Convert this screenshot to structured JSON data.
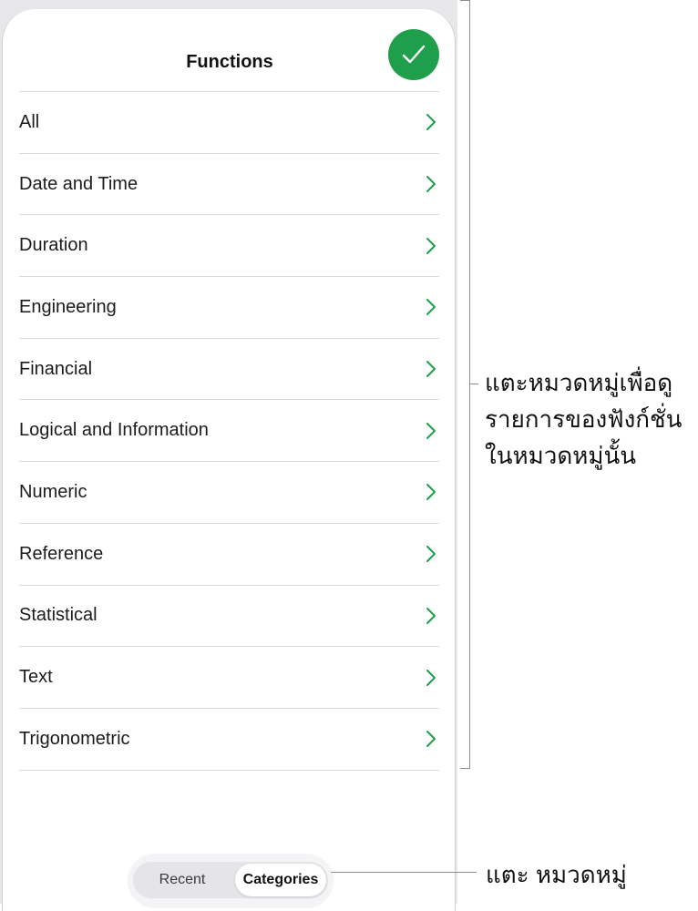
{
  "panel": {
    "title": "Functions",
    "done_icon": "checkmark-icon",
    "accent_color": "#1f9f4c"
  },
  "categories": [
    {
      "label": "All"
    },
    {
      "label": "Date and Time"
    },
    {
      "label": "Duration"
    },
    {
      "label": "Engineering"
    },
    {
      "label": "Financial"
    },
    {
      "label": "Logical and Information"
    },
    {
      "label": "Numeric"
    },
    {
      "label": "Reference"
    },
    {
      "label": "Statistical"
    },
    {
      "label": "Text"
    },
    {
      "label": "Trigonometric"
    }
  ],
  "segmented_control": {
    "options": [
      "Recent",
      "Categories"
    ],
    "selected": "Categories"
  },
  "annotations": {
    "list_callout": "แตะหมวดหมู่เพื่อดูรายการของฟังก์ชั่นในหมวดหมู่นั้น",
    "segment_callout": "แตะ หมวดหมู่"
  }
}
